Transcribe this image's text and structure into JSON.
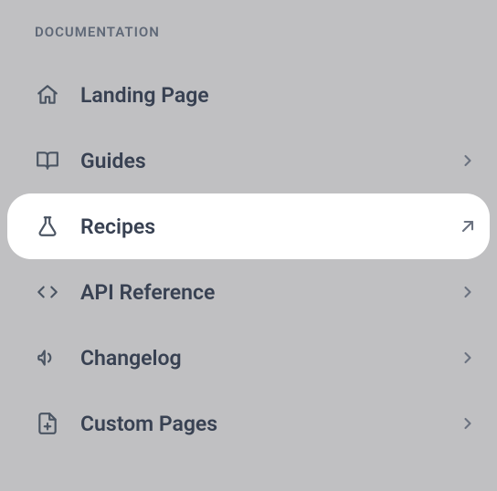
{
  "section_label": "DOCUMENTATION",
  "nav": {
    "items": [
      {
        "label": "Landing Page",
        "icon": "home-icon",
        "chevron": "none",
        "active": false
      },
      {
        "label": "Guides",
        "icon": "book-icon",
        "chevron": "right",
        "active": false
      },
      {
        "label": "Recipes",
        "icon": "flask-icon",
        "chevron": "arrow-up-right",
        "active": true
      },
      {
        "label": "API Reference",
        "icon": "code-icon",
        "chevron": "right",
        "active": false
      },
      {
        "label": "Changelog",
        "icon": "megaphone-icon",
        "chevron": "right",
        "active": false
      },
      {
        "label": "Custom Pages",
        "icon": "file-plus-icon",
        "chevron": "right",
        "active": false
      }
    ]
  }
}
